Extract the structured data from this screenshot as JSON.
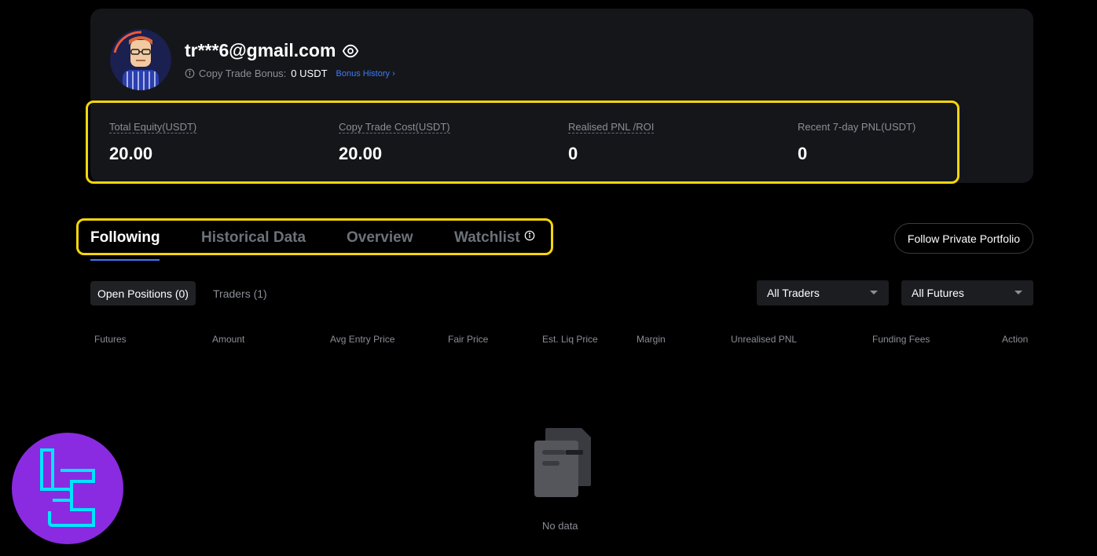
{
  "profile": {
    "email": "tr***6@gmail.com",
    "bonus_label": "Copy Trade Bonus:",
    "bonus_value": "0 USDT",
    "bonus_history": "Bonus History"
  },
  "stats": [
    {
      "label": "Total Equity(USDT)",
      "value": "20.00"
    },
    {
      "label": "Copy Trade Cost(USDT)",
      "value": "20.00"
    },
    {
      "label": "Realised PNL /ROI",
      "value": "0"
    },
    {
      "label": "Recent 7-day PNL(USDT)",
      "value": "0"
    }
  ],
  "tabs": [
    {
      "label": "Following",
      "active": true
    },
    {
      "label": "Historical Data"
    },
    {
      "label": "Overview"
    },
    {
      "label": "Watchlist"
    }
  ],
  "follow_button": "Follow Private Portfolio",
  "subtabs": {
    "open_positions": "Open Positions (0)",
    "traders": "Traders (1)"
  },
  "filters": {
    "traders": "All Traders",
    "futures": "All Futures"
  },
  "table": {
    "columns": [
      "Futures",
      "Amount",
      "Avg Entry Price",
      "Fair Price",
      "Est. Liq Price",
      "Margin",
      "Unrealised PNL",
      "Funding Fees",
      "Action"
    ]
  },
  "empty_state": "No data",
  "colors": {
    "accent_blue": "#3e7bfa",
    "highlight_yellow": "#f5d60a",
    "card_bg": "#15161a",
    "muted_text": "#8b8e96",
    "logo_purple": "#8a2be2",
    "logo_cyan": "#00e5ff"
  }
}
